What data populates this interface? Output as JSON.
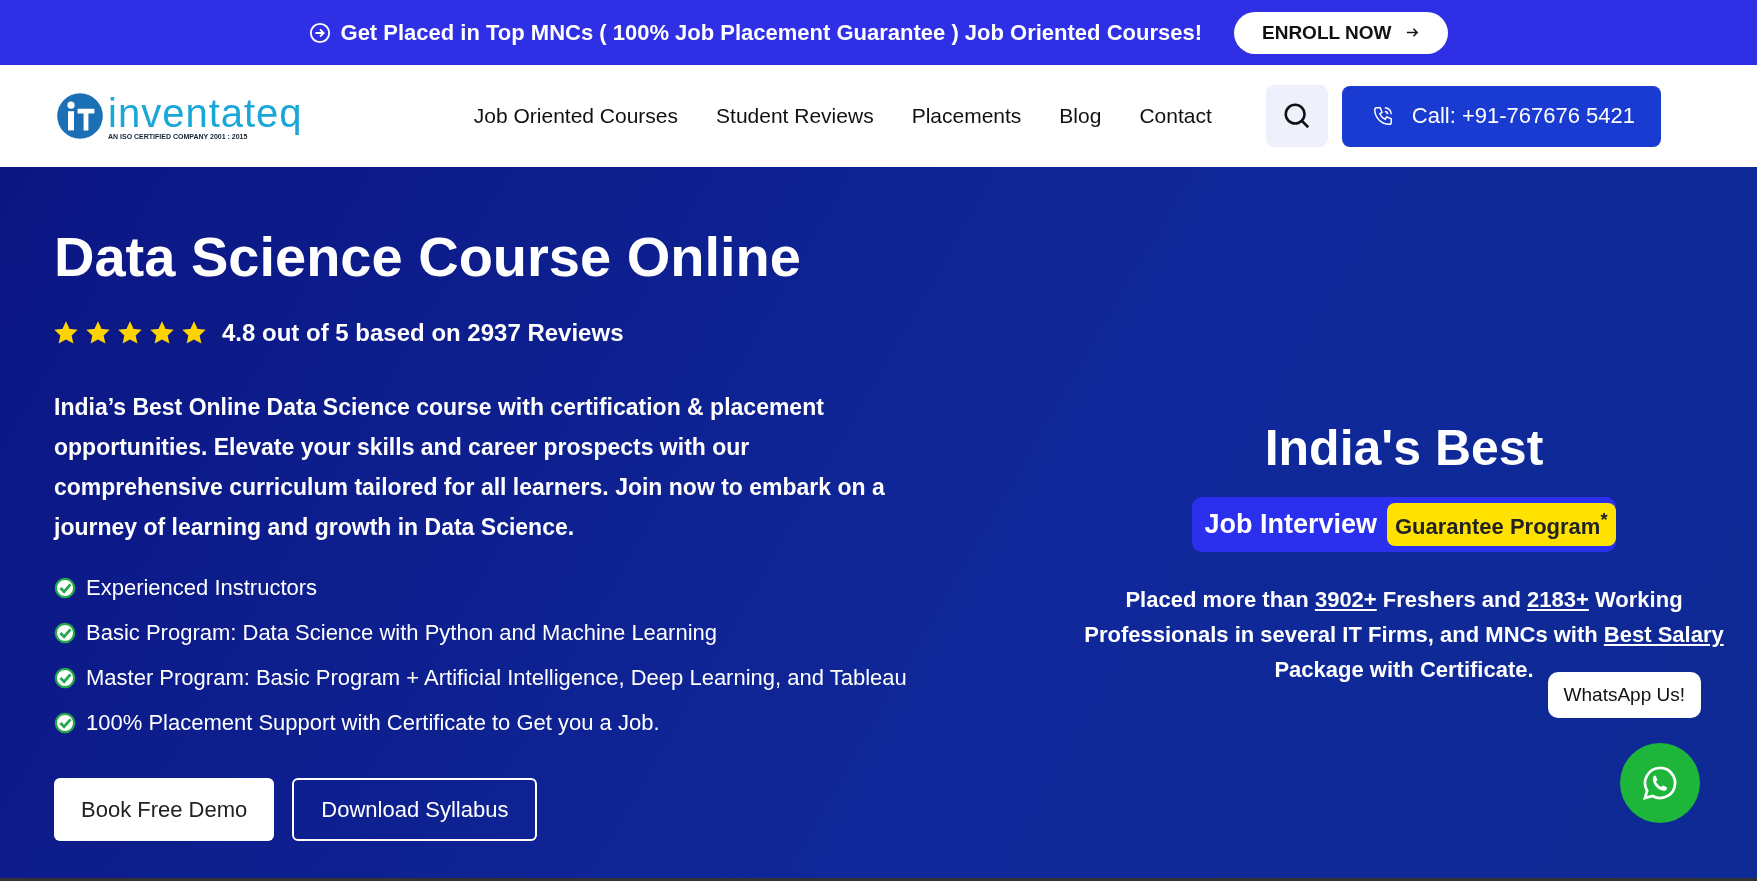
{
  "banner": {
    "text": "Get Placed in Top MNCs ( 100% Job Placement Guarantee ) Job Oriented Courses!",
    "button": "ENROLL NOW"
  },
  "nav": {
    "logo": {
      "name": "inventateq",
      "tagline": "AN ISO CERTIFIED COMPANY 2001 : 2015"
    },
    "links": [
      "Job Oriented Courses",
      "Student Reviews",
      "Placements",
      "Blog",
      "Contact"
    ],
    "call_button": "Call: +91-767676 5421"
  },
  "hero": {
    "title": "Data Science Course Online",
    "rating": {
      "stars": 5,
      "text": "4.8 out of 5 based on 2937 Reviews"
    },
    "description": "India’s Best Online Data Science course with certification & placement opportunities. Elevate your skills and career prospects with our comprehensive curriculum tailored for all learners. Join now to embark on a journey of learning and growth in Data Science.",
    "features": [
      "Experienced Instructors",
      "Basic Program: Data Science with Python and Machine Learning",
      "Master Program: Basic Program + Artificial Intelligence, Deep Learning, and Tableau",
      "100% Placement Support with Certificate to Get you a Job."
    ],
    "buttons": [
      {
        "label": "Book Free Demo",
        "kind": "solid"
      },
      {
        "label": "Download Syllabus",
        "kind": "outline"
      }
    ]
  },
  "promo": {
    "heading": "India's Best",
    "badge_main": "Job Interview",
    "badge_highlight": "Guarantee Program$^{*}$",
    "stats": [
      {
        "kind": "text",
        "text": "Placed more than "
      },
      {
        "kind": "link",
        "text": "3902+"
      },
      {
        "kind": "text",
        "text": " Freshers and "
      },
      {
        "kind": "link",
        "text": "2183+"
      },
      {
        "kind": "text",
        "text": " Working Professionals in several IT Firms, and MNCs with "
      },
      {
        "kind": "link",
        "text": "Best Salary"
      },
      {
        "kind": "text",
        "text": " Package with Certificate."
      }
    ]
  },
  "whatsapp": {
    "label": "WhatsApp Us!"
  }
}
